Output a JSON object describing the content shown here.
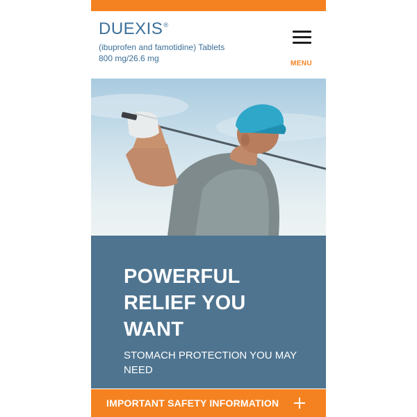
{
  "header": {
    "brand": "DUEXIS",
    "brand_mark": "®",
    "subtitle_line1": "(ibuprofen and famotidine) Tablets",
    "subtitle_line2": "800 mg/26.6 mg",
    "menu_label": "MENU",
    "menu_icon": "hamburger-icon"
  },
  "hero": {
    "image": "golfer-swinging-photo"
  },
  "main": {
    "headline_line1": "POWERFUL",
    "headline_line2": "RELIEF YOU",
    "headline_line3": "WANT",
    "subhead": "STOMACH PROTECTION YOU MAY NEED"
  },
  "footer": {
    "isi_label": "IMPORTANT SAFETY INFORMATION",
    "isi_icon": "plus-icon"
  },
  "colors": {
    "accent_orange": "#f58220",
    "brand_blue": "#3b6f99",
    "panel_blue": "#4e7490",
    "white": "#ffffff"
  }
}
